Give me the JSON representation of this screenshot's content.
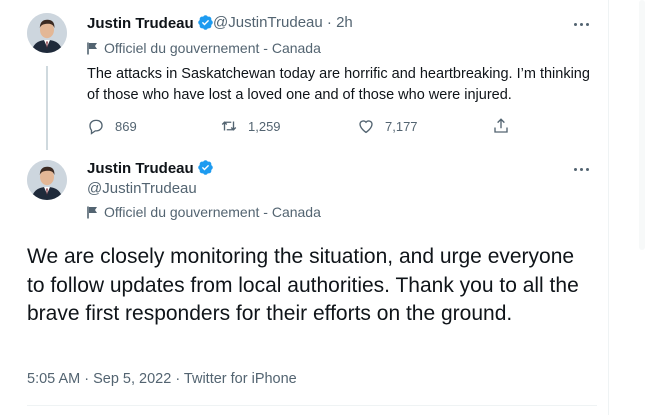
{
  "tweet1": {
    "name": "Justin Trudeau",
    "handle": "@JustinTrudeau",
    "separator": "·",
    "time": "2h",
    "government_label": "Officiel du gouvernement - Canada",
    "text": "The attacks in Saskatchewan today are horrific and heartbreaking. I’m thinking of those who have lost a loved one and of those who were injured.",
    "replies": "869",
    "retweets": "1,259",
    "likes": "7,177"
  },
  "tweet2": {
    "name": "Justin Trudeau",
    "handle": "@JustinTrudeau",
    "government_label": "Officiel du gouvernement - Canada",
    "text": "We are closely monitoring the situation, and urge everyone to follow updates from local authorities. Thank you to all the brave first responders for their efforts on the ground.",
    "timestamp": "5:05 AM · Sep 5, 2022 · Twitter for iPhone"
  },
  "colors": {
    "text_primary": "#0f1419",
    "text_secondary": "#536471",
    "verified_blue": "#1d9bf0",
    "thread_line": "#cfd9de"
  },
  "icons": {
    "verified": "verified-badge-icon",
    "flag": "government-flag-icon",
    "more": "more-dots-icon",
    "reply": "reply-icon",
    "retweet": "retweet-icon",
    "like": "heart-icon",
    "share": "share-icon"
  }
}
